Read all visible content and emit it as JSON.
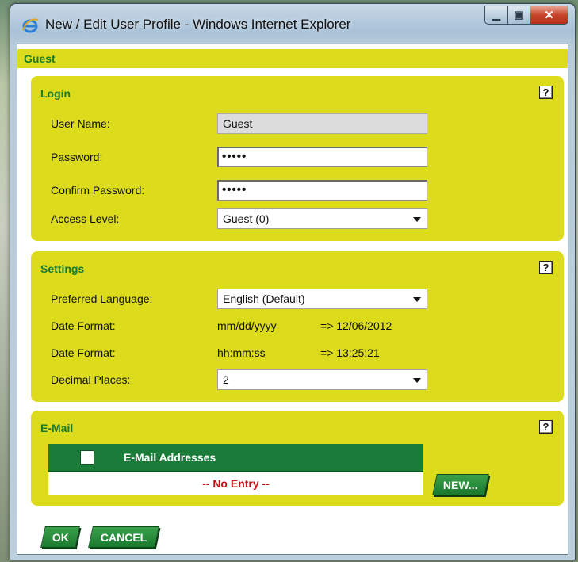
{
  "window": {
    "title": "New / Edit User Profile - Windows Internet Explorer"
  },
  "header": {
    "title": "Guest"
  },
  "login": {
    "title": "Login",
    "help": "?",
    "user_name_label": "User Name:",
    "user_name_value": "Guest",
    "password_label": "Password:",
    "password_value": "•••••",
    "confirm_label": "Confirm Password:",
    "confirm_value": "•••••",
    "access_label": "Access Level:",
    "access_value": "Guest (0)"
  },
  "settings": {
    "title": "Settings",
    "help": "?",
    "language_label": "Preferred Language:",
    "language_value": "English (Default)",
    "date_format_label": "Date Format:",
    "date_format_value": "mm/dd/yyyy",
    "date_preview": "=> 12/06/2012",
    "time_format_label": "Date Format:",
    "time_format_value": "hh:mm:ss",
    "time_preview": "=> 13:25:21",
    "decimal_label": "Decimal Places:",
    "decimal_value": "2"
  },
  "email": {
    "title": "E-Mail",
    "help": "?",
    "column_header": "E-Mail Addresses",
    "empty_text": "-- No Entry --",
    "new_button": "NEW..."
  },
  "footer": {
    "ok_label": "OK",
    "cancel_label": "CANCEL"
  },
  "colors": {
    "panel": "#dcdc1c",
    "accent_green": "#1b7b38",
    "title_green": "#1a7a2e",
    "empty_red": "#c3141a"
  },
  "icons": {
    "app": "ie-icon",
    "help": "help-icon",
    "minimize": "minimize-icon",
    "maximize": "maximize-icon",
    "close": "close-icon"
  }
}
